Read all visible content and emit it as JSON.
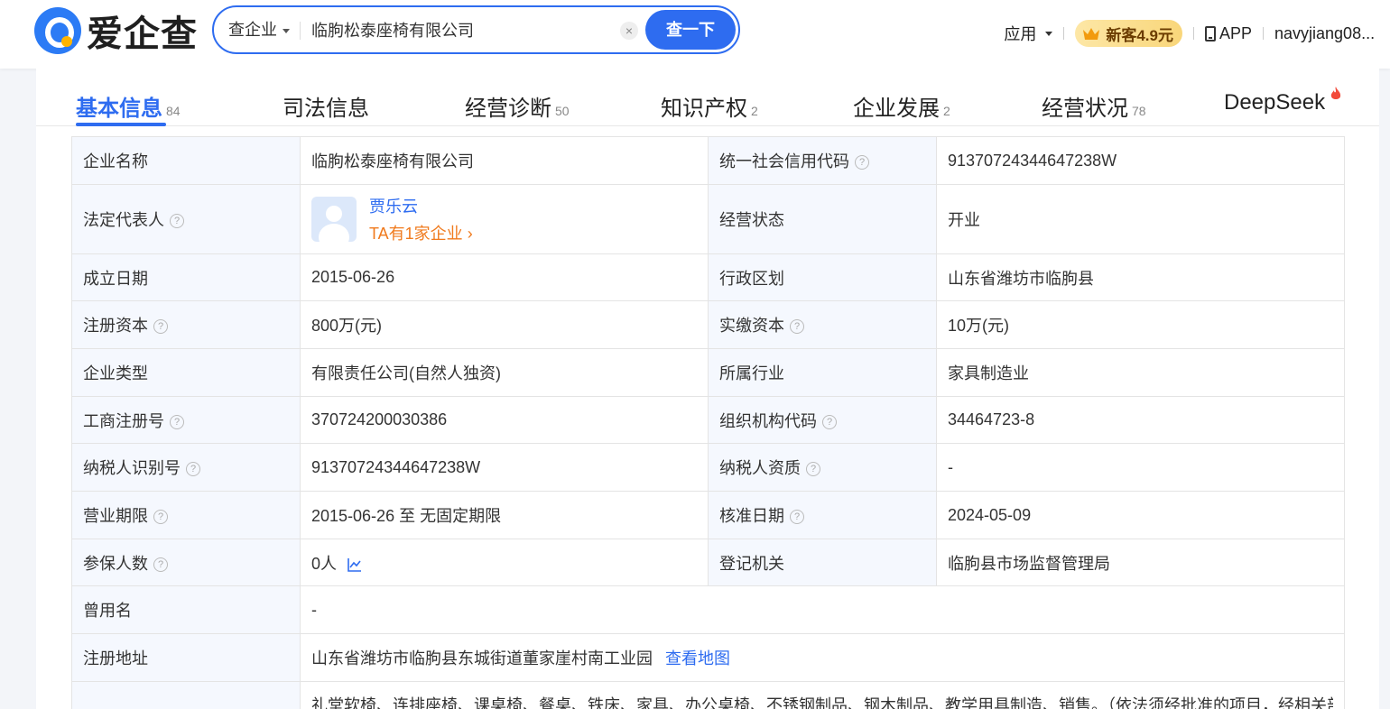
{
  "header": {
    "logo_text": "爱企查",
    "search": {
      "type_label": "查企业",
      "value": "临朐松泰座椅有限公司",
      "clear": "×",
      "button": "查一下"
    },
    "nav": {
      "app_menu": "应用",
      "vip": "新客4.9元",
      "app": "APP",
      "user": "navyjiang08..."
    }
  },
  "tabs": [
    {
      "label": "基本信息",
      "count": "84"
    },
    {
      "label": "司法信息",
      "count": ""
    },
    {
      "label": "经营诊断",
      "count": "50"
    },
    {
      "label": "知识产权",
      "count": "2"
    },
    {
      "label": "企业发展",
      "count": "2"
    },
    {
      "label": "经营状况",
      "count": "78"
    },
    {
      "label": "DeepSeek",
      "count": ""
    }
  ],
  "info": {
    "company_name_label": "企业名称",
    "company_name": "临朐松泰座椅有限公司",
    "credit_code_label": "统一社会信用代码",
    "credit_code": "91370724344647238W",
    "legal_rep_label": "法定代表人",
    "legal_rep_name": "贾乐云",
    "legal_rep_companies": "TA有1家企业",
    "status_label": "经营状态",
    "status": "开业",
    "founded_label": "成立日期",
    "founded": "2015-06-26",
    "region_label": "行政区划",
    "region": "山东省潍坊市临朐县",
    "reg_capital_label": "注册资本",
    "reg_capital": "800万(元)",
    "paid_capital_label": "实缴资本",
    "paid_capital": "10万(元)",
    "company_type_label": "企业类型",
    "company_type": "有限责任公司(自然人独资)",
    "industry_label": "所属行业",
    "industry": "家具制造业",
    "biz_reg_no_label": "工商注册号",
    "biz_reg_no": "370724200030386",
    "org_code_label": "组织机构代码",
    "org_code": "34464723-8",
    "taxpayer_id_label": "纳税人识别号",
    "taxpayer_id": "91370724344647238W",
    "taxpayer_qual_label": "纳税人资质",
    "taxpayer_qual": "-",
    "term_label": "营业期限",
    "term": "2015-06-26 至 无固定期限",
    "approval_date_label": "核准日期",
    "approval_date": "2024-05-09",
    "insured_label": "参保人数",
    "insured": "0人",
    "authority_label": "登记机关",
    "authority": "临朐县市场监督管理局",
    "former_name_label": "曾用名",
    "former_name": "-",
    "address_label": "注册地址",
    "address": "山东省潍坊市临朐县东城街道董家崖村南工业园",
    "view_map": "查看地图",
    "scope": "礼堂软椅、连排座椅、课桌椅、餐桌、铁床、家具、办公桌椅、不锈钢制品、钢木制品、教学用具制造、销售。（依法须经批准的项目，经相关部"
  },
  "colors": {
    "accent": "#2e6cf0",
    "orange": "#f07a1d",
    "label_bg": "#f5f8fe"
  }
}
